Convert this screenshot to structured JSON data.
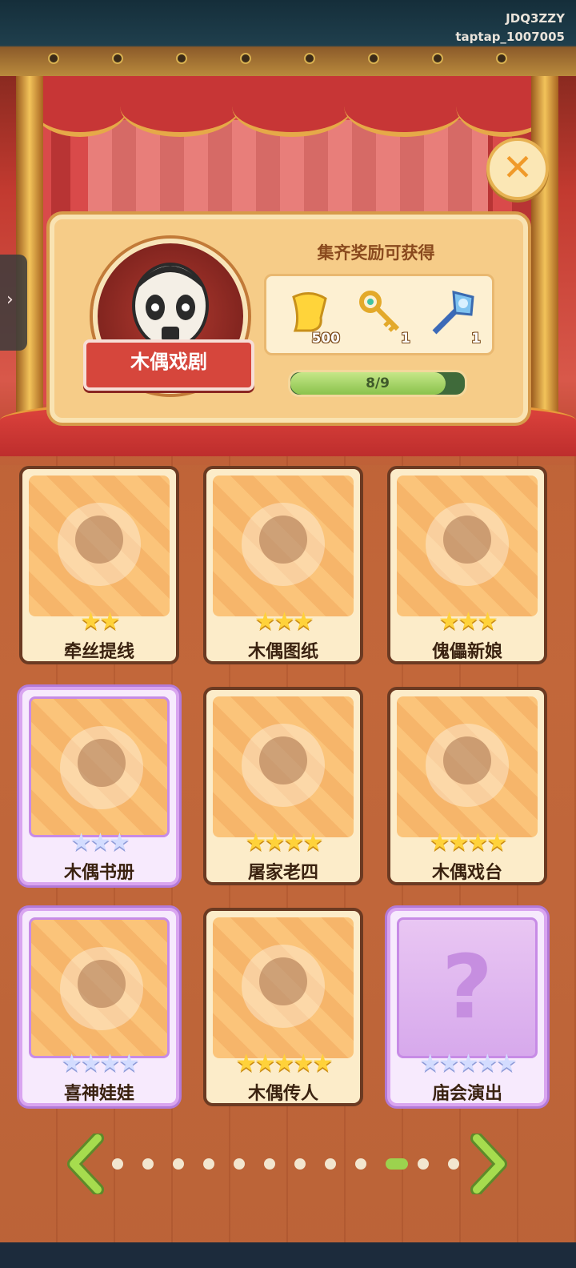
{
  "watermark": {
    "line1": "JDQ3ZZY",
    "line2": "taptap_1007005"
  },
  "side_tab": {
    "icon": "chevron-right-icon",
    "glyph": "›"
  },
  "close_button": {
    "icon": "close-icon",
    "glyph": "✕"
  },
  "collection": {
    "name": "木偶戏剧",
    "reward_title": "集齐奖励可获得",
    "rewards": [
      {
        "icon": "gold-currency-icon",
        "quantity": "500"
      },
      {
        "icon": "golden-key-icon",
        "quantity": "1"
      },
      {
        "icon": "crystal-scepter-icon",
        "quantity": "1"
      }
    ],
    "progress": {
      "text": "8/9",
      "collected": 8,
      "total": 9
    }
  },
  "cards": [
    {
      "label": "牵丝提线",
      "stars": "★★",
      "tier": "gold",
      "art": "wooden-cross-strings"
    },
    {
      "label": "木偶图纸",
      "stars": "★★★",
      "tier": "gold",
      "art": "blueprint-scroll"
    },
    {
      "label": "傀儡新娘",
      "stars": "★★★",
      "tier": "gold",
      "art": "bride-puppet"
    },
    {
      "label": "木偶书册",
      "stars": "★★★",
      "tier": "silver",
      "art": "puppet-book"
    },
    {
      "label": "屠家老四",
      "stars": "★★★★",
      "tier": "gold",
      "art": "masked-puppet"
    },
    {
      "label": "木偶戏台",
      "stars": "★★★★",
      "tier": "gold",
      "art": "puppet-stage"
    },
    {
      "label": "喜神娃娃",
      "stars": "★★★★",
      "tier": "silver",
      "art": "joy-god-doll"
    },
    {
      "label": "木偶传人",
      "stars": "★★★★★",
      "tier": "gold",
      "art": "puppet-heir"
    },
    {
      "label": "庙会演出",
      "stars": "★★★★★",
      "tier": "silver",
      "art": "locked-question"
    }
  ],
  "pagination": {
    "total_pages": 12,
    "current_page": 10,
    "prev_icon": "chevron-left-icon",
    "next_icon": "chevron-right-icon"
  }
}
